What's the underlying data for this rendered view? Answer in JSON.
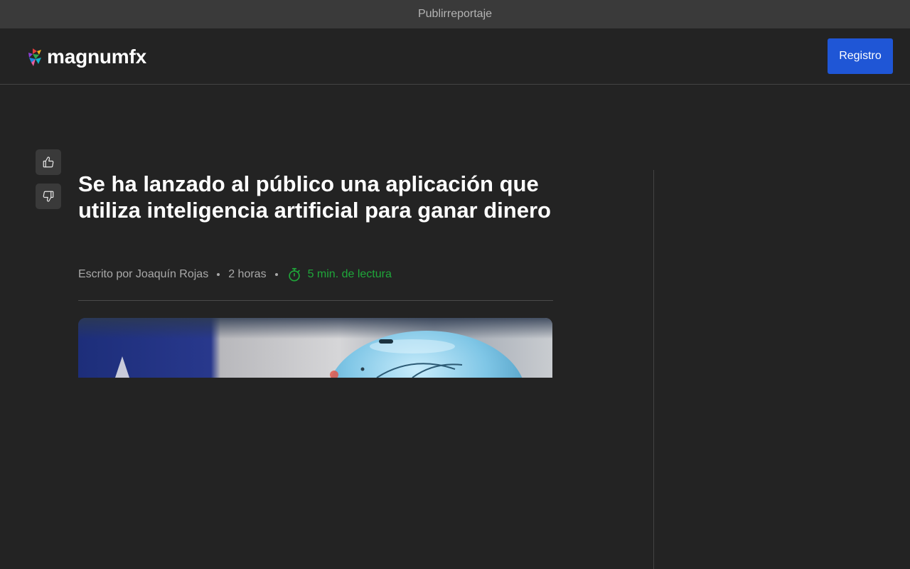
{
  "banner": {
    "text": "Publirreportaje"
  },
  "header": {
    "logo_text": "magnumfx",
    "register_label": "Registro"
  },
  "article": {
    "title": "Se ha lanzado al público una aplicación que utiliza inteligencia artificial para ganar dinero",
    "author": "Escrito por Joaquín Rojas",
    "time_ago": "2 horas",
    "read_time": "5 min. de lectura"
  },
  "icons": {
    "like": "thumbs-up-icon",
    "dislike": "thumbs-down-icon",
    "read_time": "stopwatch-icon"
  },
  "colors": {
    "background": "#232323",
    "banner": "#3a3a3a",
    "accent_button": "#1f56d6",
    "read_time": "#1fa83a"
  }
}
